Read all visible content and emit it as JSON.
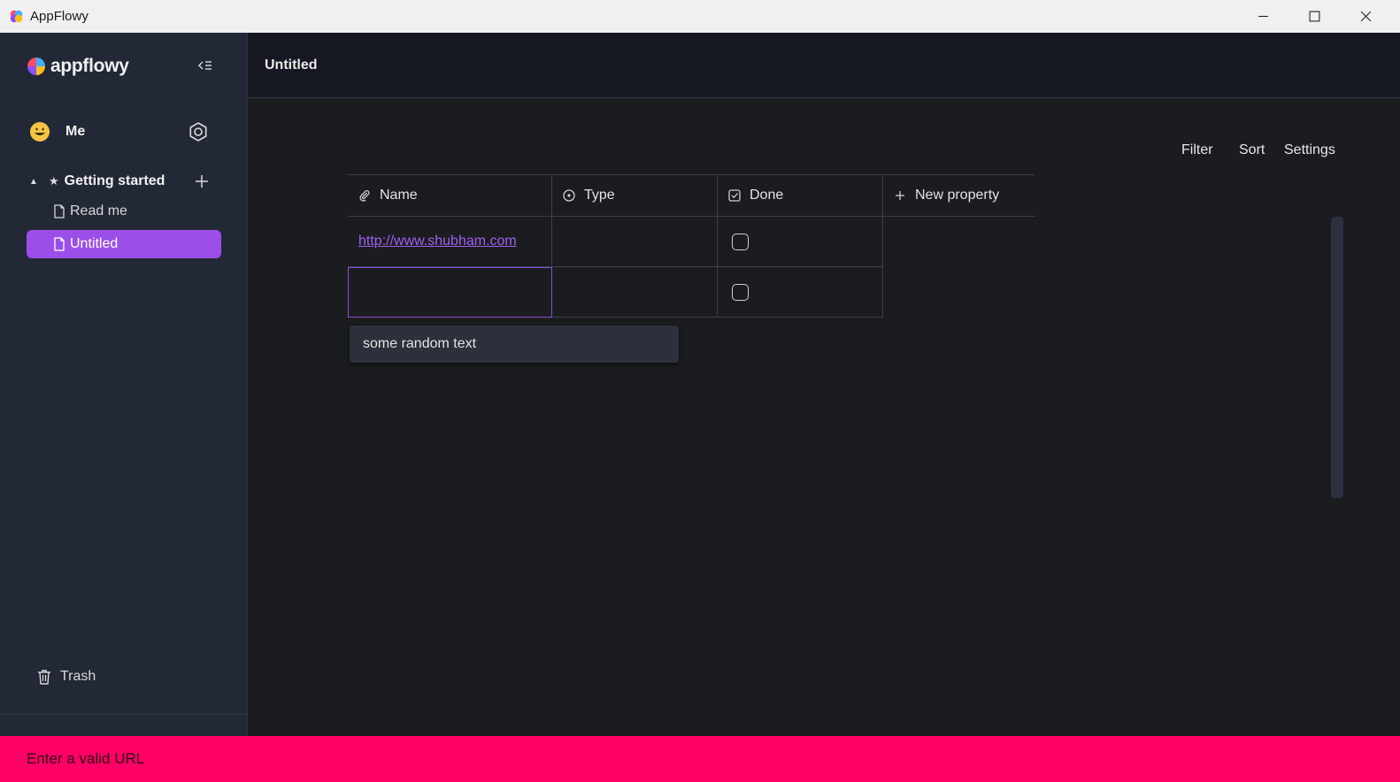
{
  "window": {
    "title": "AppFlowy"
  },
  "sidebar": {
    "logo_text": "appflowy",
    "user": {
      "name": "Me"
    },
    "workspace": {
      "name": "Getting started"
    },
    "pages": [
      {
        "label": "Read me",
        "active": false
      },
      {
        "label": "Untitled",
        "active": true
      }
    ],
    "trash_label": "Trash"
  },
  "main": {
    "title": "Untitled",
    "toolbar": {
      "filter": "Filter",
      "sort": "Sort",
      "settings": "Settings"
    },
    "grid": {
      "columns": [
        {
          "label": "Name",
          "icon": "paperclip-icon"
        },
        {
          "label": "Type",
          "icon": "circle-dot-icon"
        },
        {
          "label": "Done",
          "icon": "checkbox-icon"
        },
        {
          "label": "New property",
          "icon": "plus-icon"
        }
      ],
      "rows": [
        {
          "name": "http://www.shubham.com",
          "type": "",
          "done": false
        },
        {
          "name": "",
          "type": "",
          "done": false
        }
      ]
    },
    "suggestion": "some random text"
  },
  "error_message": "Enter a valid URL",
  "colors": {
    "accent": "#9b4fe8",
    "error": "#ff0066",
    "link": "#a25ff0"
  }
}
